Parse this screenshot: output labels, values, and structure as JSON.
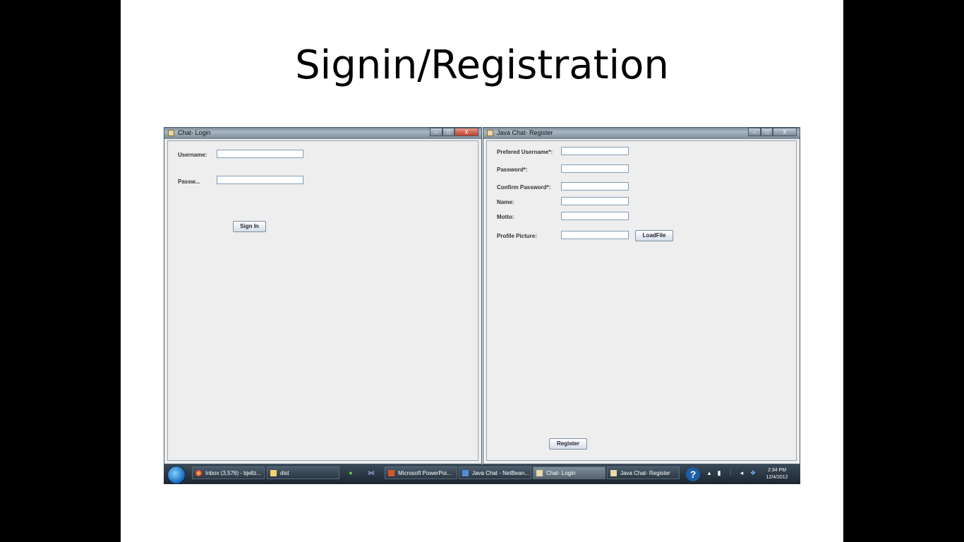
{
  "slide": {
    "title": "Signin/Registration"
  },
  "login_window": {
    "title": "Chat- Login",
    "controls": {
      "minimize": "–",
      "maximize": "□",
      "close": "X"
    },
    "username_label": "Username:",
    "username_value": "",
    "password_label": "Passw...",
    "password_value": "",
    "signin_button": "Sign In"
  },
  "register_window": {
    "title": "Java Chat- Register",
    "controls": {
      "minimize": "–",
      "maximize": "□",
      "close": "X"
    },
    "fields": [
      {
        "label": "Prefered Username*:",
        "value": ""
      },
      {
        "label": "Password*:",
        "value": ""
      },
      {
        "label": "Confirm Password*:",
        "value": ""
      },
      {
        "label": "Name:",
        "value": ""
      },
      {
        "label": "Motto:",
        "value": ""
      },
      {
        "label": "Profile Picture:",
        "value": ""
      }
    ],
    "loadfile_button": "LoadFile",
    "register_button": "Register"
  },
  "taskbar": {
    "items": [
      {
        "label": "Inbox (3,576) - bjellz...",
        "icon": "chrome-icon"
      },
      {
        "label": "dist",
        "icon": "folder-icon"
      },
      {
        "label": "Microsoft PowerPoi...",
        "icon": "powerpoint-icon"
      },
      {
        "label": "Java Chat - NetBean...",
        "icon": "netbeans-icon"
      },
      {
        "label": "Chat- Login",
        "icon": "java-icon"
      },
      {
        "label": "Java Chat- Register",
        "icon": "java-icon"
      }
    ],
    "help": "?",
    "clock_time": "2:34 PM",
    "clock_date": "12/4/2012"
  }
}
